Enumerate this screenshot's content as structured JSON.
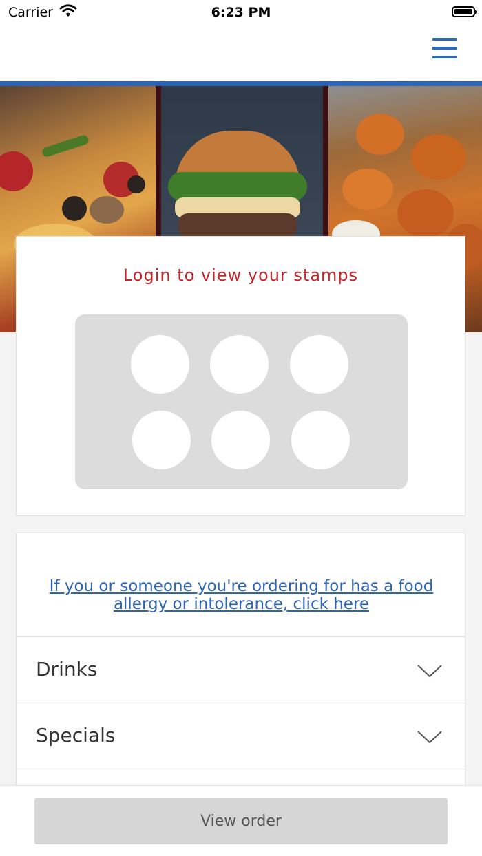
{
  "status_bar": {
    "carrier": "Carrier",
    "time": "6:23 PM",
    "wifi_icon": "wifi-icon",
    "battery_icon": "battery-icon"
  },
  "header": {
    "menu_icon": "hamburger-menu-icon",
    "accent_color": "#2d64b4"
  },
  "banner": {
    "images": [
      "pizza-image",
      "burger-image",
      "chicken-skewers-image"
    ]
  },
  "stamps": {
    "title": "Login to view your stamps",
    "title_color": "#c4262a",
    "stamp_count": 6
  },
  "allergy": {
    "link_text": "If you or someone you're ordering for has a food allergy or intolerance, click here"
  },
  "categories": [
    {
      "label": "Drinks",
      "icon": "chevron-down-icon"
    },
    {
      "label": "Specials",
      "icon": "chevron-down-icon"
    }
  ],
  "footer": {
    "view_order_label": "View order"
  }
}
